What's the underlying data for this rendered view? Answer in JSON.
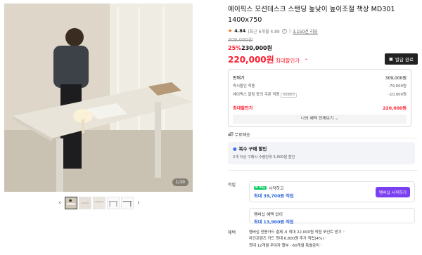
{
  "gallery": {
    "counter": "1/10",
    "thumbs_prev": "‹",
    "thumbs_next": "›"
  },
  "product": {
    "title": "에이픽스 모션데스크 스탠딩 높낮이 높이조절 책상 MD301 1400x750",
    "rating": "4.84",
    "rating_detail": "(최근 6개월 4.89",
    "reviews": "3,150건 리뷰",
    "original_price": "309,000원",
    "discount_pct": "25%",
    "discount_price": "230,000원",
    "max_price": "220,000원",
    "max_label": "최대할인가",
    "coupon_button": "발급 완료"
  },
  "price_box": {
    "rows": [
      {
        "label": "판매가",
        "value": "309,000원"
      },
      {
        "label": "즉시할인 적용",
        "value": "-79,000원"
      },
      {
        "label": "에이픽스 알림 등의 쿠폰 적용",
        "tag": "최대할인",
        "value": "-10,000원"
      }
    ],
    "total_label": "최대할인가",
    "total_value": "220,000원",
    "benefit_button": "나의 혜택 전체보기"
  },
  "shipping": {
    "label": "무료배송"
  },
  "multi_discount": {
    "title": "복수 구매 할인",
    "desc": "2개 이상 구매시 수량단위 5,000원 할인"
  },
  "accumulate": {
    "section_label": "적립",
    "badge": "N Pay",
    "membership": "시작하고",
    "membership_amount": "최대 39,700원 적립",
    "start_button": "멤버십 시작하기",
    "no_member": "멤버십 혜택 없이",
    "no_member_amount": "최대 13,900원 적립"
  },
  "benefits": {
    "section_label": "혜택",
    "lines": [
      "멤버십 전용카드 결제 시 최대 22,000원 적립 포인트 받기",
      "라인프렌즈 카드 최대 6,800원 추가 적립(4%)",
      "최대 12개월 무이자 할부 · 60개월 특별금리"
    ]
  },
  "colors": {
    "accent": "#ff1b2d",
    "purple": "#7b3ff2",
    "blue": "#2b66d9",
    "npay": "#03c75a"
  }
}
